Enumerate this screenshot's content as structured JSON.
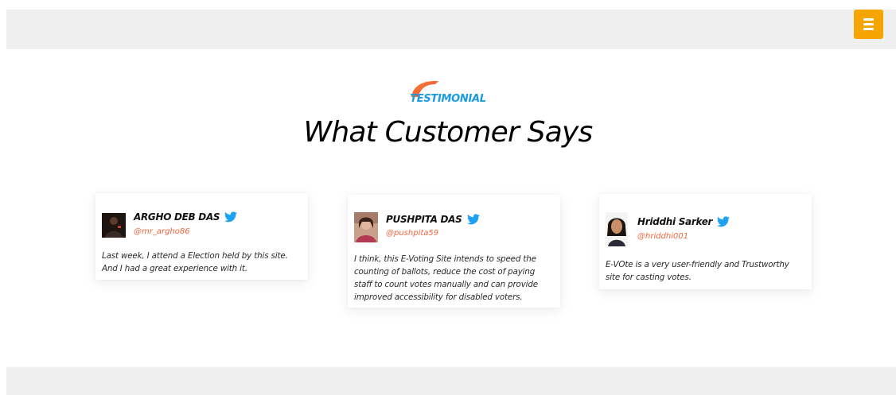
{
  "header": {
    "menu_icon": "hamburger-menu-icon",
    "accent_color": "#f5a400"
  },
  "section": {
    "badge_label": "TESTIMONIAL",
    "badge_color": "#1a9be0",
    "badge_shape_color": "#f0663e",
    "title": "What Customer Says"
  },
  "testimonials": [
    {
      "name": "ARGHO DEB DAS",
      "handle": "@mr_argho86",
      "icon": "twitter-icon",
      "quote": "Last week, I attend a Election held by this site. And I had a great experience with it."
    },
    {
      "name": "PUSHPITA DAS",
      "handle": "@pushpita59",
      "icon": "twitter-icon",
      "quote": "I think, this E-Voting Site intends to speed the counting of ballots, reduce the cost of paying staff to count votes manually and can provide improved accessibility for disabled voters."
    },
    {
      "name": "Hriddhi Sarker",
      "handle": "@hriddhi001",
      "icon": "twitter-icon",
      "quote": "E-VOte is a very user-friendly and Trustworthy site for casting votes."
    }
  ],
  "colors": {
    "handle": "#f0663e",
    "twitter": "#1da1f2",
    "bar_bg": "#efefef"
  }
}
